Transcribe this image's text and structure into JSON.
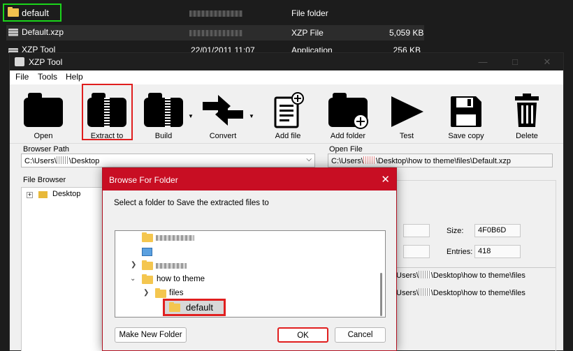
{
  "explorer": {
    "rows": [
      {
        "name": "default",
        "type": "File folder",
        "size": ""
      },
      {
        "name": "Default.xzp",
        "type": "XZP File",
        "size": "5,059 KB"
      },
      {
        "name": "XZP Tool",
        "date": "22/01/2011 11:07",
        "type": "Application",
        "size": "256 KB"
      }
    ]
  },
  "xzp": {
    "title": "XZP Tool",
    "menu": [
      "File",
      "Tools",
      "Help"
    ],
    "toolbar": [
      "Open",
      "Extract to",
      "Build",
      "Convert",
      "Add file",
      "Add folder",
      "Test",
      "Save copy",
      "Delete"
    ],
    "browser_path_label": "Browser Path",
    "browser_path_prefix": "C:\\Users\\",
    "browser_path_suffix": "\\Desktop",
    "open_file_label": "Open File",
    "open_file_prefix": "C:\\Users\\",
    "open_file_suffix": "\\Desktop\\how to theme\\files\\Default.xzp",
    "file_browser_label": "File Browser",
    "tree_root": "Desktop",
    "size_label": "Size:",
    "size_value": "4F0B6D",
    "entries_label": "Entries:",
    "entries_value": "418",
    "path_rows_suffix": "\\Desktop\\how to theme\\files",
    "path_rows_prefix": "Users\\"
  },
  "dialog": {
    "title": "Browse For Folder",
    "message": "Select a folder to Save the extracted files to",
    "tree": {
      "how_to_theme": "how to theme",
      "files": "files",
      "default": "default"
    },
    "make_new_folder": "Make New Folder",
    "ok": "OK",
    "cancel": "Cancel"
  }
}
